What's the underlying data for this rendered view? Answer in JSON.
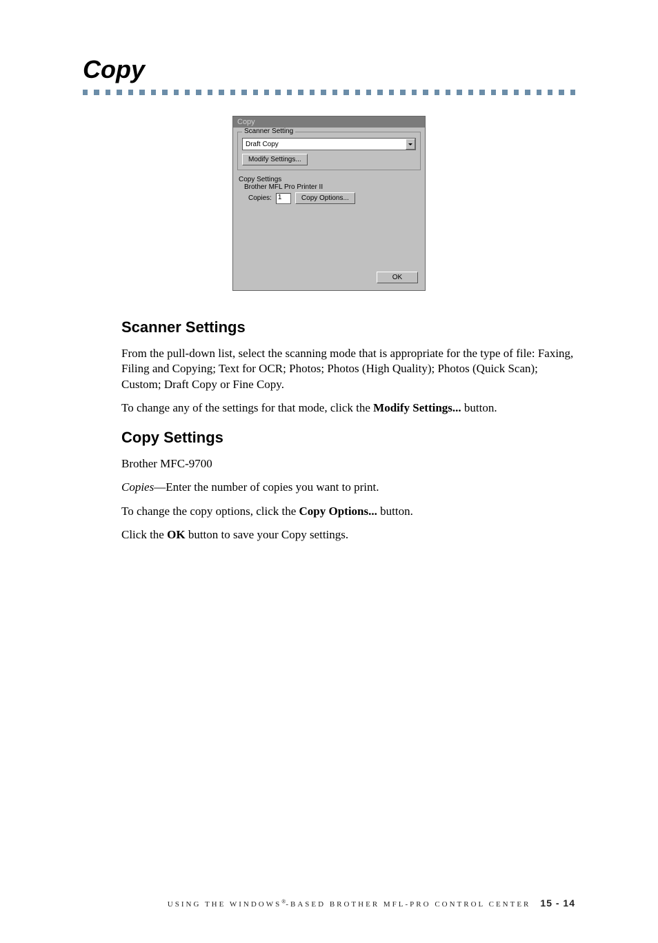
{
  "heading": "Copy",
  "dialog": {
    "title": "Copy",
    "scanner_setting_legend": "Scanner Setting",
    "scanner_mode": "Draft Copy",
    "modify_settings_btn": "Modify Settings...",
    "copy_settings_label": "Copy Settings",
    "printer_name": "Brother MFL Pro Printer II",
    "copies_label": "Copies:",
    "copies_value": "1",
    "copy_options_btn": "Copy Options...",
    "ok_btn": "OK"
  },
  "sections": {
    "scanner_settings_heading": "Scanner Settings",
    "scanner_settings_p1": "From the pull-down list, select the scanning mode that is appropriate for the type of file: Faxing, Filing and Copying; Text for OCR; Photos; Photos (High Quality); Photos (Quick Scan); Custom; Draft Copy or Fine Copy.",
    "scanner_settings_p2_a": "To change any of the settings for that mode, click the ",
    "scanner_settings_p2_bold": "Modify Settings...",
    "scanner_settings_p2_c": " button.",
    "copy_settings_heading": "Copy Settings",
    "copy_settings_p1": "Brother MFC-9700",
    "copy_settings_p2_italic": "Copies",
    "copy_settings_p2_rest": "—Enter the number of copies you want to print.",
    "copy_settings_p3_a": "To change the copy options, click the ",
    "copy_settings_p3_bold": "Copy Options...",
    "copy_settings_p3_c": " button.",
    "copy_settings_p4_a": "Click the ",
    "copy_settings_p4_bold": "OK",
    "copy_settings_p4_c": " button to save your Copy settings."
  },
  "footer": {
    "text_a": "USING THE WINDOWS",
    "reg": "®",
    "text_b": "-BASED BROTHER MFL-PRO CONTROL CENTER",
    "page": "15 - 14"
  }
}
